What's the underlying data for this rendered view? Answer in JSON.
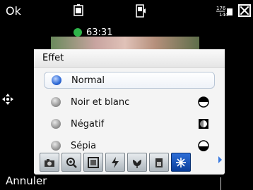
{
  "topbar": {
    "left_label": "Ok",
    "icons": [
      "camera-mode-icon",
      "video-mode-icon",
      "resolution-icon",
      "close-icon"
    ],
    "resolution_top": "176",
    "resolution_bottom": "144"
  },
  "recording": {
    "timer": "63:31",
    "indicator_color": "#2fb44a"
  },
  "popup": {
    "title": "Effet",
    "options": [
      {
        "label": "Normal",
        "selected": true,
        "icon": null
      },
      {
        "label": "Noir et blanc",
        "selected": false,
        "icon": "half-filled-circle-icon"
      },
      {
        "label": "Négatif",
        "selected": false,
        "icon": "inverted-square-icon"
      },
      {
        "label": "Sépia",
        "selected": false,
        "icon": "sepia-circle-icon"
      }
    ],
    "toolbar": [
      {
        "icon": "camera-settings-icon",
        "active": false
      },
      {
        "icon": "zoom-icon",
        "active": false
      },
      {
        "icon": "frame-icon",
        "active": false
      },
      {
        "icon": "flash-icon",
        "active": false
      },
      {
        "icon": "macro-icon",
        "active": false
      },
      {
        "icon": "brightness-icon",
        "active": false
      },
      {
        "icon": "effect-icon",
        "active": true
      }
    ]
  },
  "softkeys": {
    "left": "Annuler"
  },
  "colors": {
    "accent": "#2d69d6",
    "popup_bg": "#f4f4f4"
  }
}
